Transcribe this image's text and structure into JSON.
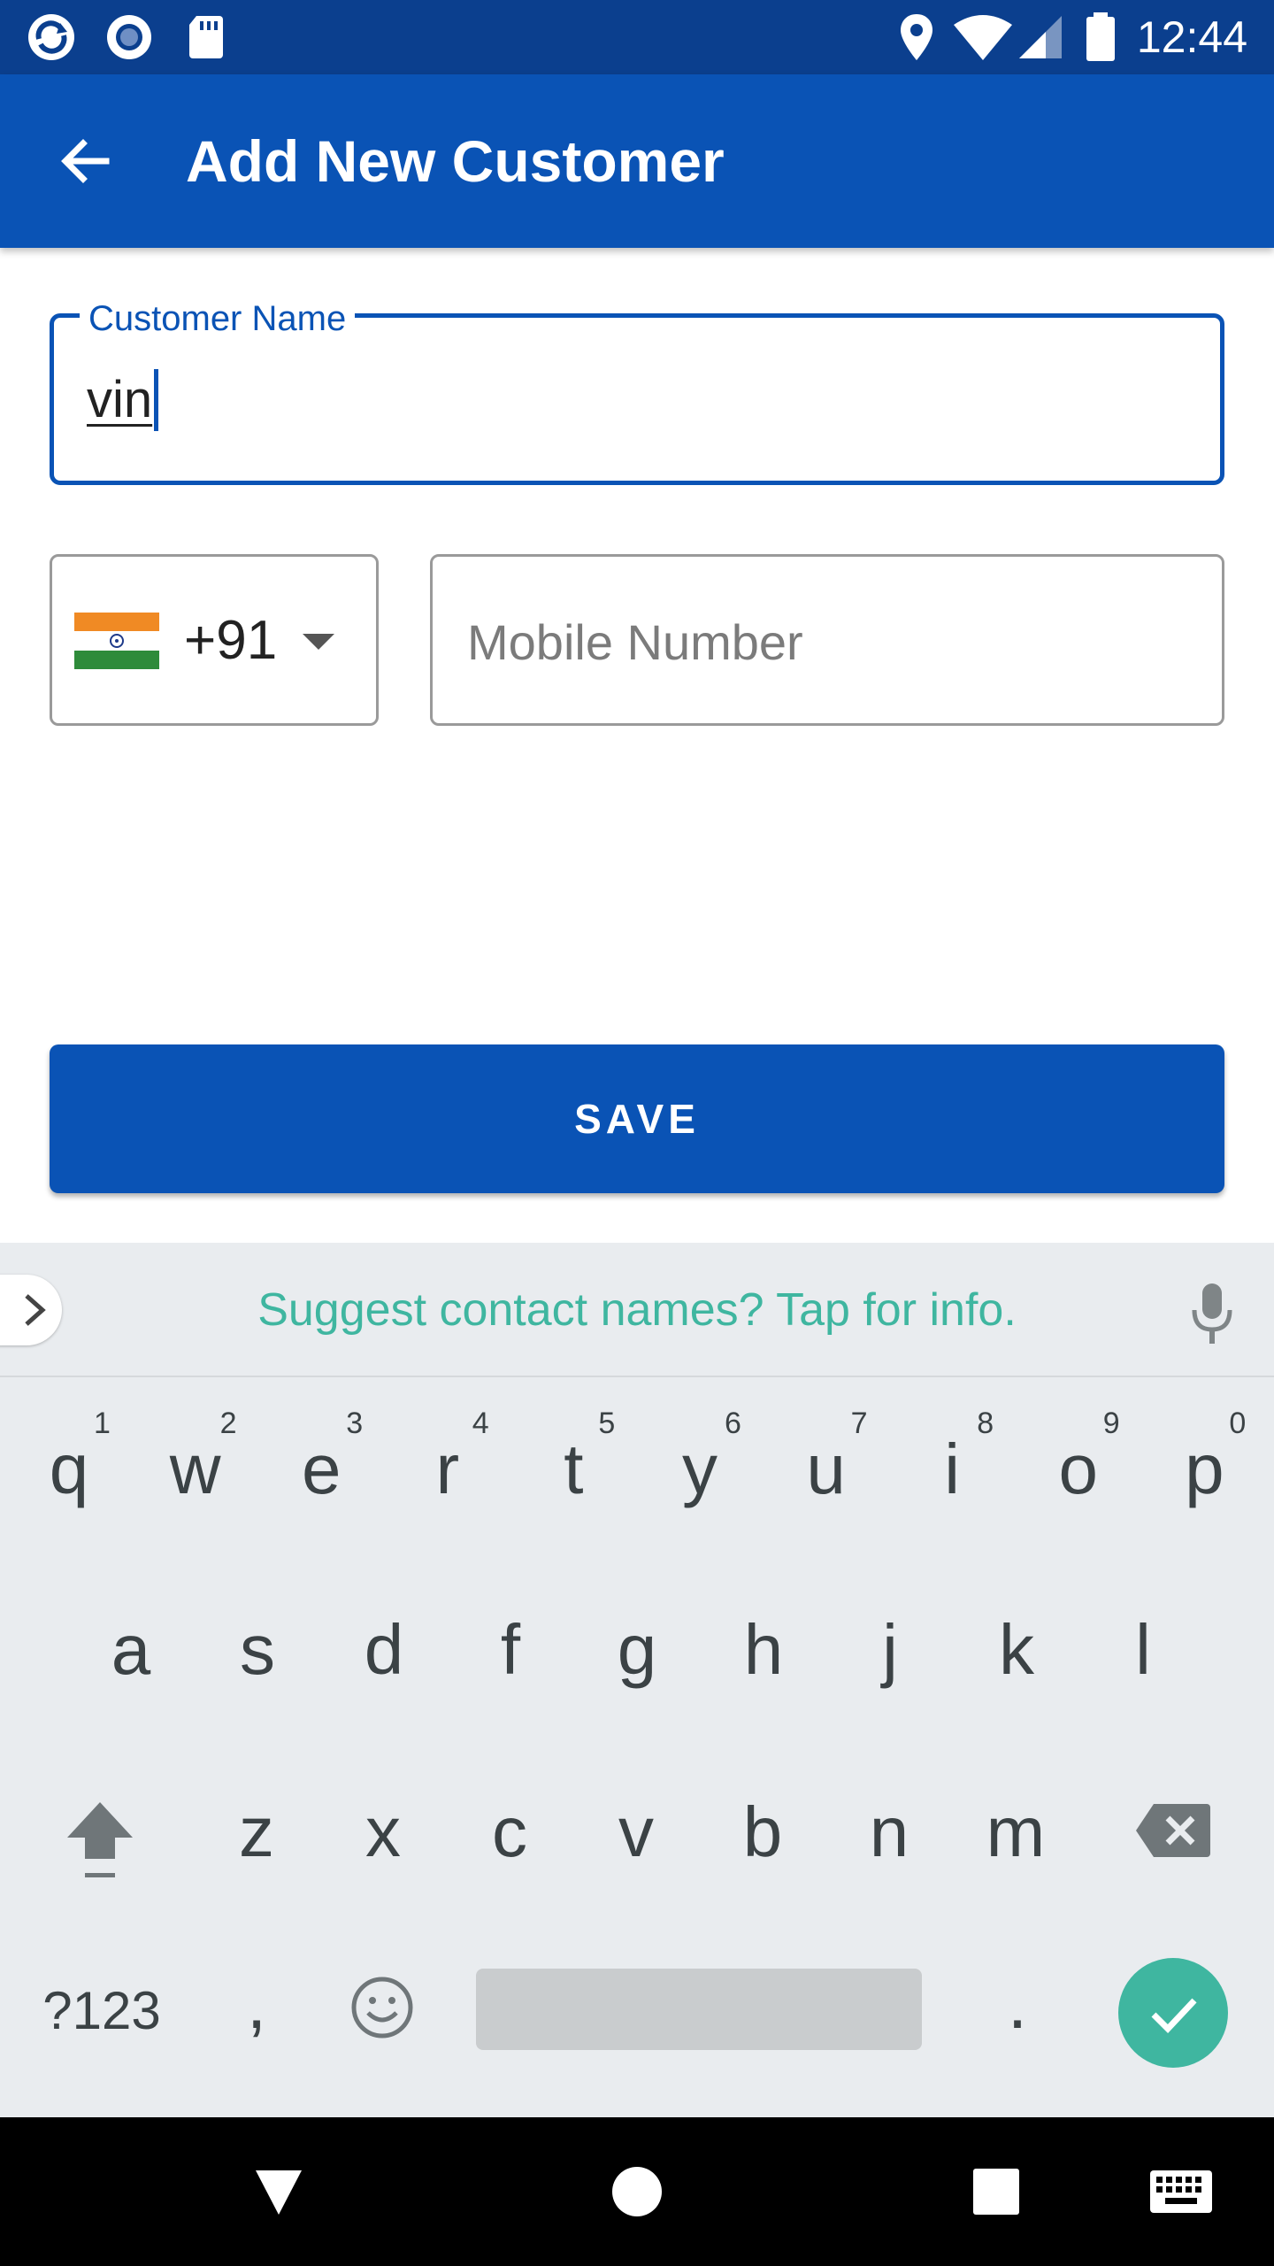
{
  "status_bar": {
    "time": "12:44",
    "icons": [
      "app-sync-icon",
      "record-icon",
      "sd-card-icon",
      "location-icon",
      "wifi-icon",
      "signal-icon",
      "battery-icon"
    ]
  },
  "app_bar": {
    "title": "Add New Customer",
    "back_icon": "arrow-left-icon"
  },
  "form": {
    "customer_name": {
      "label": "Customer Name",
      "value": "vin"
    },
    "country_code": {
      "flag": "india-flag",
      "value": "+91"
    },
    "mobile_number": {
      "placeholder": "Mobile Number",
      "value": ""
    },
    "save_label": "SAVE"
  },
  "keyboard": {
    "suggestion_text": "Suggest contact names? Tap for info.",
    "row1": [
      {
        "key": "q",
        "hint": "1"
      },
      {
        "key": "w",
        "hint": "2"
      },
      {
        "key": "e",
        "hint": "3"
      },
      {
        "key": "r",
        "hint": "4"
      },
      {
        "key": "t",
        "hint": "5"
      },
      {
        "key": "y",
        "hint": "6"
      },
      {
        "key": "u",
        "hint": "7"
      },
      {
        "key": "i",
        "hint": "8"
      },
      {
        "key": "o",
        "hint": "9"
      },
      {
        "key": "p",
        "hint": "0"
      }
    ],
    "row2": [
      "a",
      "s",
      "d",
      "f",
      "g",
      "h",
      "j",
      "k",
      "l"
    ],
    "row3": [
      "z",
      "x",
      "c",
      "v",
      "b",
      "n",
      "m"
    ],
    "symbols_label": "?123",
    "comma_label": ",",
    "period_label": "."
  },
  "colors": {
    "primary": "#0a53b5",
    "status_bar": "#0b3f8e",
    "accent": "#3fb6a0"
  }
}
